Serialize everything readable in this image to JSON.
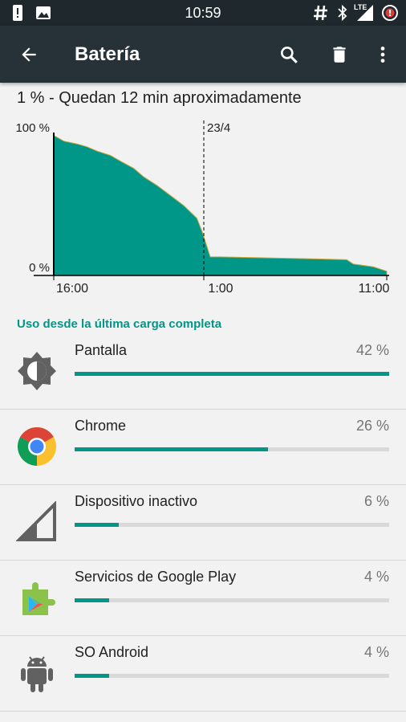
{
  "status_bar": {
    "time": "10:59",
    "network": "LTE"
  },
  "app_bar": {
    "title": "Batería"
  },
  "summary": "1 % - Quedan 12 min aproximadamente",
  "chart_data": {
    "type": "area",
    "y_tick_labels": [
      "100 %",
      "0 %"
    ],
    "x_tick_labels": [
      "16:00",
      "1:00",
      "11:00"
    ],
    "marker_label": "23/4",
    "ylim": [
      0,
      100
    ],
    "series": [
      {
        "x": [
          0,
          0.03,
          0.07,
          0.1,
          0.13,
          0.17,
          0.2,
          0.24,
          0.27,
          0.31,
          0.35,
          0.39,
          0.43,
          0.445,
          0.455,
          0.47,
          0.5,
          0.6,
          0.7,
          0.8,
          0.88,
          0.9,
          0.93,
          0.96,
          1.0
        ],
        "values": [
          98,
          94,
          92,
          90,
          87,
          84,
          80,
          75,
          69,
          63,
          56,
          49,
          40,
          31,
          24,
          13,
          13,
          12.5,
          12,
          11.5,
          11,
          8,
          7,
          6,
          3
        ]
      }
    ]
  },
  "section_title": "Uso desde la última carga completa",
  "usage": [
    {
      "name": "Pantalla",
      "percent_label": "42 %",
      "fraction": 1.0,
      "icon": "brightness-icon"
    },
    {
      "name": "Chrome",
      "percent_label": "26 %",
      "fraction": 0.615,
      "icon": "chrome-icon"
    },
    {
      "name": "Dispositivo inactivo",
      "percent_label": "6 %",
      "fraction": 0.14,
      "icon": "cell-signal-icon"
    },
    {
      "name": "Servicios de Google Play",
      "percent_label": "4 %",
      "fraction": 0.11,
      "icon": "google-play-services-icon"
    },
    {
      "name": "SO Android",
      "percent_label": "4 %",
      "fraction": 0.11,
      "icon": "android-icon"
    }
  ],
  "colors": {
    "accent": "#009688",
    "toolbar": "#263238",
    "statusbar": "#1f292d",
    "track": "#d9d9d9"
  }
}
